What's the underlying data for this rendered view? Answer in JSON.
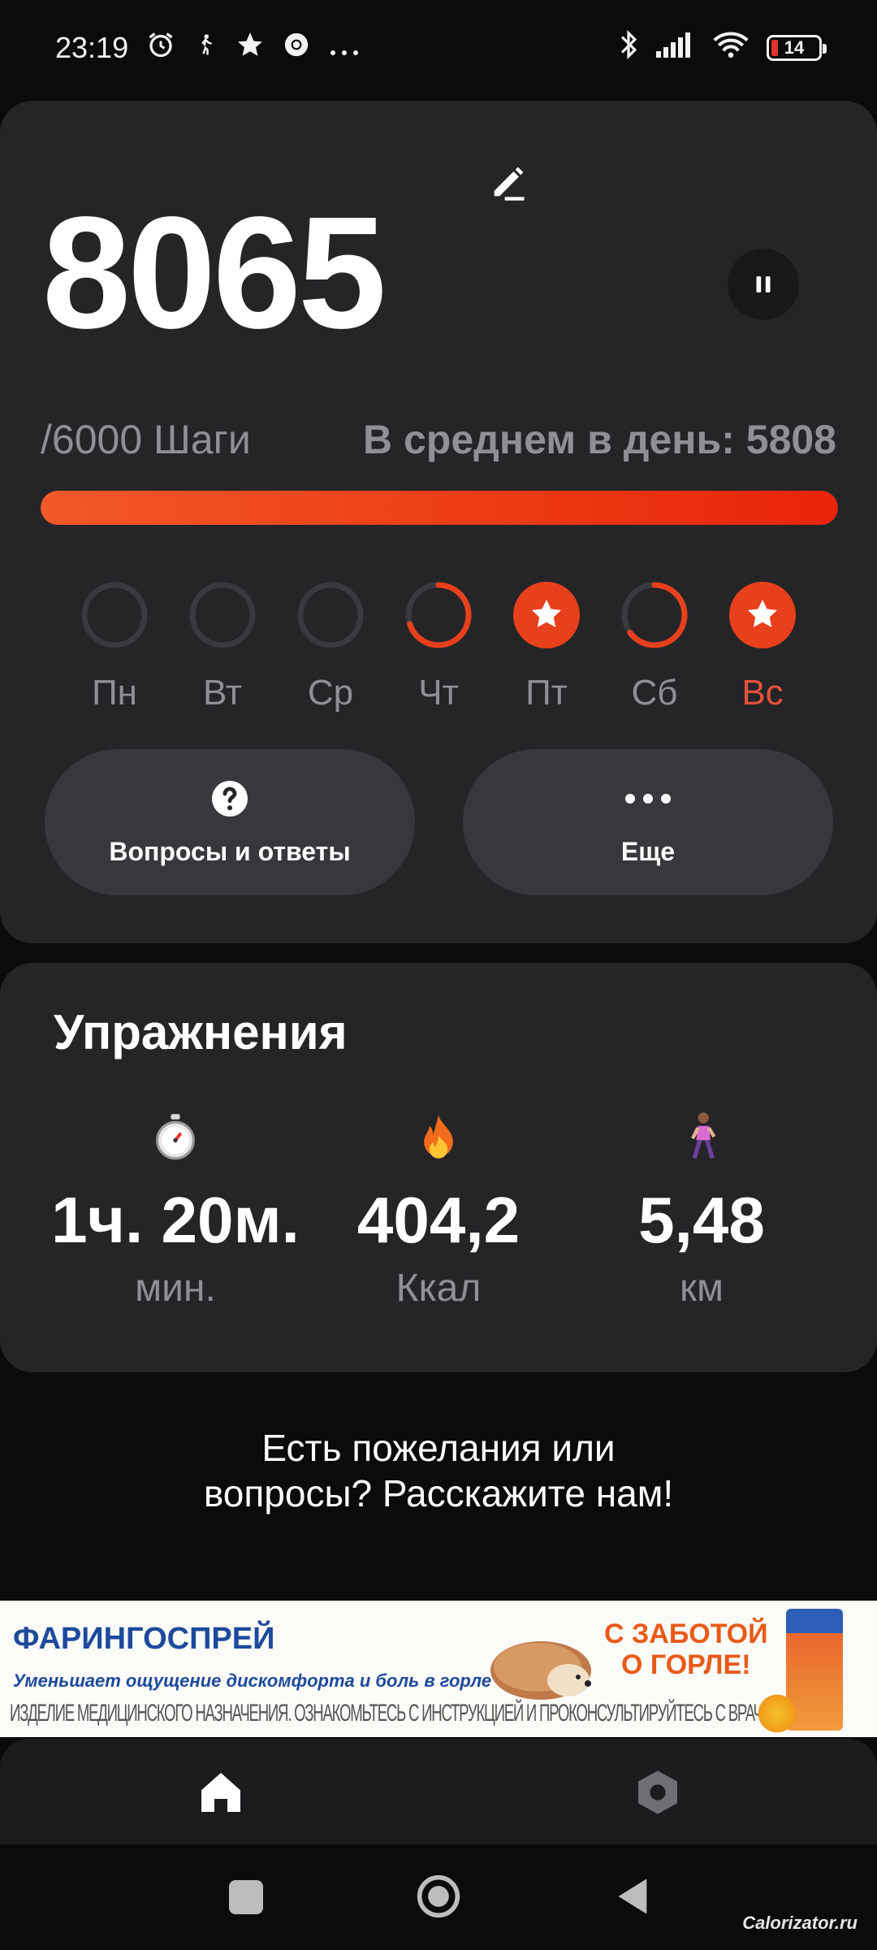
{
  "status_bar": {
    "time": "23:19",
    "battery_level": "14",
    "icons": [
      "alarm-icon",
      "walk-icon",
      "star-icon",
      "chrome-icon",
      "more-dots-icon",
      "bluetooth-icon",
      "signal-icon",
      "wifi-icon",
      "battery-icon"
    ]
  },
  "steps": {
    "count": "8065",
    "goal_label": "/6000 Шаги",
    "average_label": "В среднем в день: 5808",
    "progress_fraction": 1.0,
    "accent_color": "#ec3a13"
  },
  "week": {
    "days": [
      {
        "label": "Пн",
        "state": "empty",
        "progress": 0
      },
      {
        "label": "Вт",
        "state": "empty",
        "progress": 0
      },
      {
        "label": "Ср",
        "state": "empty",
        "progress": 0
      },
      {
        "label": "Чт",
        "state": "partial",
        "progress": 0.7
      },
      {
        "label": "Пт",
        "state": "complete",
        "progress": 1
      },
      {
        "label": "Сб",
        "state": "partial",
        "progress": 0.65
      },
      {
        "label": "Вс",
        "state": "complete",
        "progress": 1
      }
    ]
  },
  "actions": {
    "faq_label": "Вопросы и ответы",
    "more_label": "Еще"
  },
  "exercise": {
    "title": "Упражнения",
    "time_value": "1ч. 20м.",
    "time_unit": "мин.",
    "kcal_value": "404,2",
    "kcal_unit": "Ккал",
    "distance_value": "5,48",
    "distance_unit": "км"
  },
  "feedback": {
    "line1": "Есть пожелания или",
    "line2": "вопросы? Расскажите нам!"
  },
  "ad": {
    "brand": "ФАРИНГОСПРЕЙ",
    "subtitle": "Уменьшает ощущение дискомфорта и боль в горле",
    "slogan_line1": "С ЗАБОТОЙ",
    "slogan_line2": "О ГОРЛЕ!",
    "disclaimer": "ИЗДЕЛИЕ МЕДИЦИНСКОГО НАЗНАЧЕНИЯ. ОЗНАКОМЬТЕСЬ С ИНСТРУКЦИЕЙ И ПРОКОНСУЛЬТИРУЙТЕСЬ С ВРАЧОМ."
  },
  "watermark": "Calorizator.ru"
}
